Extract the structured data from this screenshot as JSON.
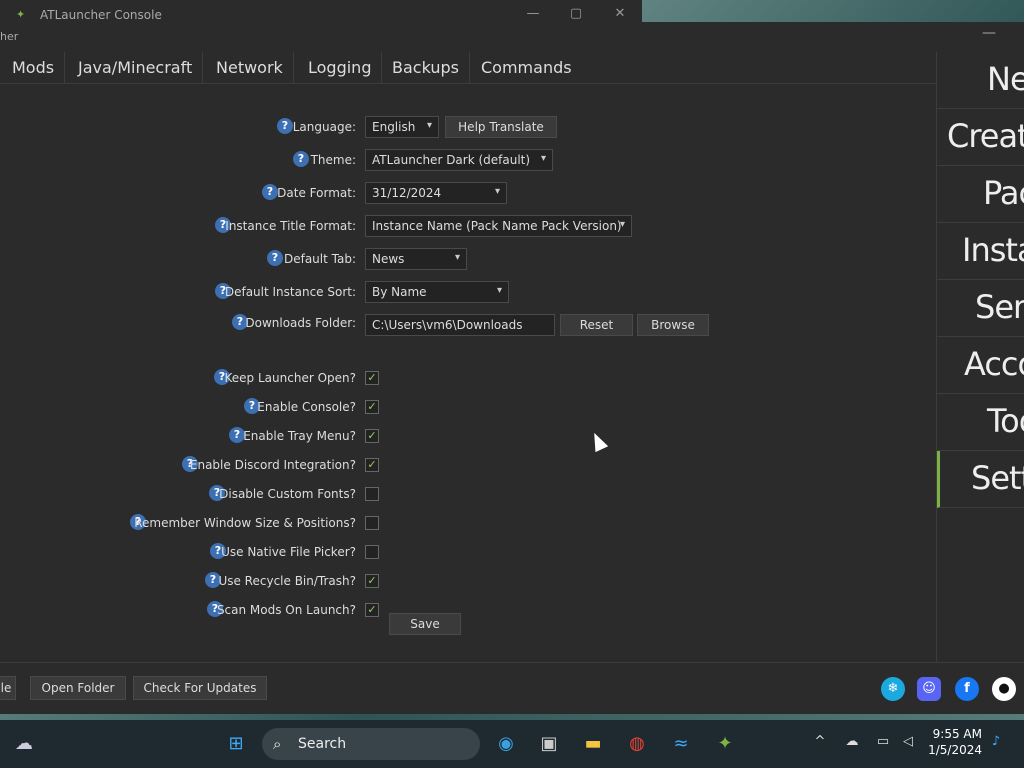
{
  "console_window": {
    "title": "ATLauncher Console",
    "icon": "atlauncher-icon"
  },
  "launcher_window": {
    "title_partial": "her"
  },
  "tabs": [
    "Mods",
    "Java/Minecraft",
    "Network",
    "Logging",
    "Backups",
    "Commands"
  ],
  "settings": {
    "language": {
      "label": "Language:",
      "value": "English",
      "help_translate": "Help Translate"
    },
    "theme": {
      "label": "Theme:",
      "value": "ATLauncher Dark (default)"
    },
    "date_format": {
      "label": "Date Format:",
      "value": "31/12/2024"
    },
    "instance_title_format": {
      "label": "Instance Title Format:",
      "value": "Instance Name (Pack Name Pack Version)"
    },
    "default_tab": {
      "label": "Default Tab:",
      "value": "News"
    },
    "default_instance_sort": {
      "label": "Default Instance Sort:",
      "value": "By Name"
    },
    "downloads_folder": {
      "label": "Downloads Folder:",
      "value": "C:\\Users\\vm6\\Downloads",
      "reset": "Reset",
      "browse": "Browse"
    },
    "checkboxes": [
      {
        "label": "Keep Launcher Open?",
        "checked": true
      },
      {
        "label": "Enable Console?",
        "checked": true
      },
      {
        "label": "Enable Tray Menu?",
        "checked": true
      },
      {
        "label": "Enable Discord Integration?",
        "checked": true
      },
      {
        "label": "Disable Custom Fonts?",
        "checked": false
      },
      {
        "label": "Remember Window Size & Positions?",
        "checked": false
      },
      {
        "label": "Use Native File Picker?",
        "checked": false
      },
      {
        "label": "Use Recycle Bin/Trash?",
        "checked": true
      },
      {
        "label": "Scan Mods On Launch?",
        "checked": true
      }
    ],
    "save": "Save",
    "help_glyph": "?"
  },
  "sidenav": [
    "News",
    "Create",
    "Packs",
    "Instances",
    "Servers",
    "Accounts",
    "Tools",
    "Settings"
  ],
  "bottom": {
    "partial_button": "le",
    "open_folder": "Open Folder",
    "check_updates": "Check For Updates"
  },
  "taskbar": {
    "search": "Search",
    "time": "9:55 AM",
    "date": "1/5/2024"
  },
  "colors": {
    "accent": "#7cb342",
    "help": "#3d6fb3",
    "bg": "#2b2b2b"
  }
}
